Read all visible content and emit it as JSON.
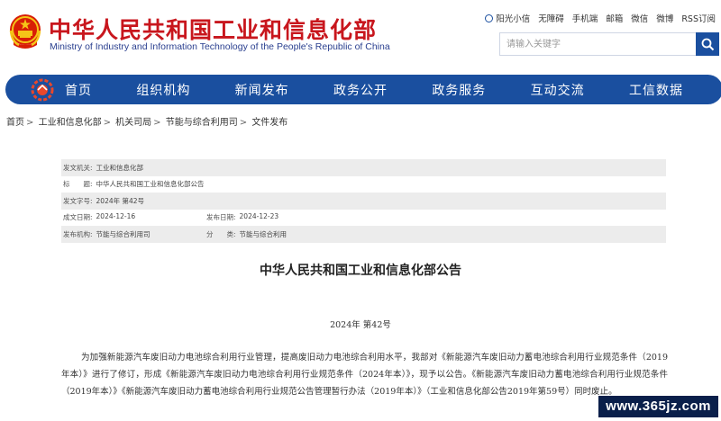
{
  "header": {
    "title": "中华人民共和国工业和信息化部",
    "subtitle": "Ministry of Industry and Information Technology of the People's Republic of China"
  },
  "toplinks": [
    "阳光小信",
    "无障碍",
    "手机端",
    "邮箱",
    "微信",
    "微博",
    "RSS订阅"
  ],
  "search": {
    "placeholder": "请输入关键字"
  },
  "nav": [
    "首页",
    "组织机构",
    "新闻发布",
    "政务公开",
    "政务服务",
    "互动交流",
    "工信数据"
  ],
  "breadcrumb": [
    "首页",
    "工业和信息化部",
    "机关司局",
    "节能与综合利用司",
    "文件发布"
  ],
  "meta": {
    "issuer_label": "发文机关:",
    "issuer": "工业和信息化部",
    "title_label": "标　　题:",
    "title": "中华人民共和国工业和信息化部公告",
    "number_label": "发文字号:",
    "number": "2024年 第42号",
    "created_label": "成文日期:",
    "created": "2024-12-16",
    "published_label": "发布日期:",
    "published": "2024-12-23",
    "org_label": "发布机构:",
    "org": "节能与综合利用司",
    "category_label": "分　　类:",
    "category": "节能与综合利用"
  },
  "document": {
    "title": "中华人民共和国工业和信息化部公告",
    "number": "2024年 第42号",
    "body": "为加强新能源汽车废旧动力电池综合利用行业管理，提高废旧动力电池综合利用水平，我部对《新能源汽车废旧动力蓄电池综合利用行业规范条件（2019年本）》进行了修订，形成《新能源汽车废旧动力电池综合利用行业规范条件（2024年本）》，现予以公告。《新能源汽车废旧动力蓄电池综合利用行业规范条件（2019年本）》《新能源汽车废旧动力蓄电池综合利用行业规范公告管理暂行办法（2019年本）》（工业和信息化部公告2019年第59号）同时废止。"
  },
  "watermark": "www.365jz.com",
  "colors": {
    "brand_red": "#c8161d",
    "nav_blue": "#1a4f9f"
  }
}
